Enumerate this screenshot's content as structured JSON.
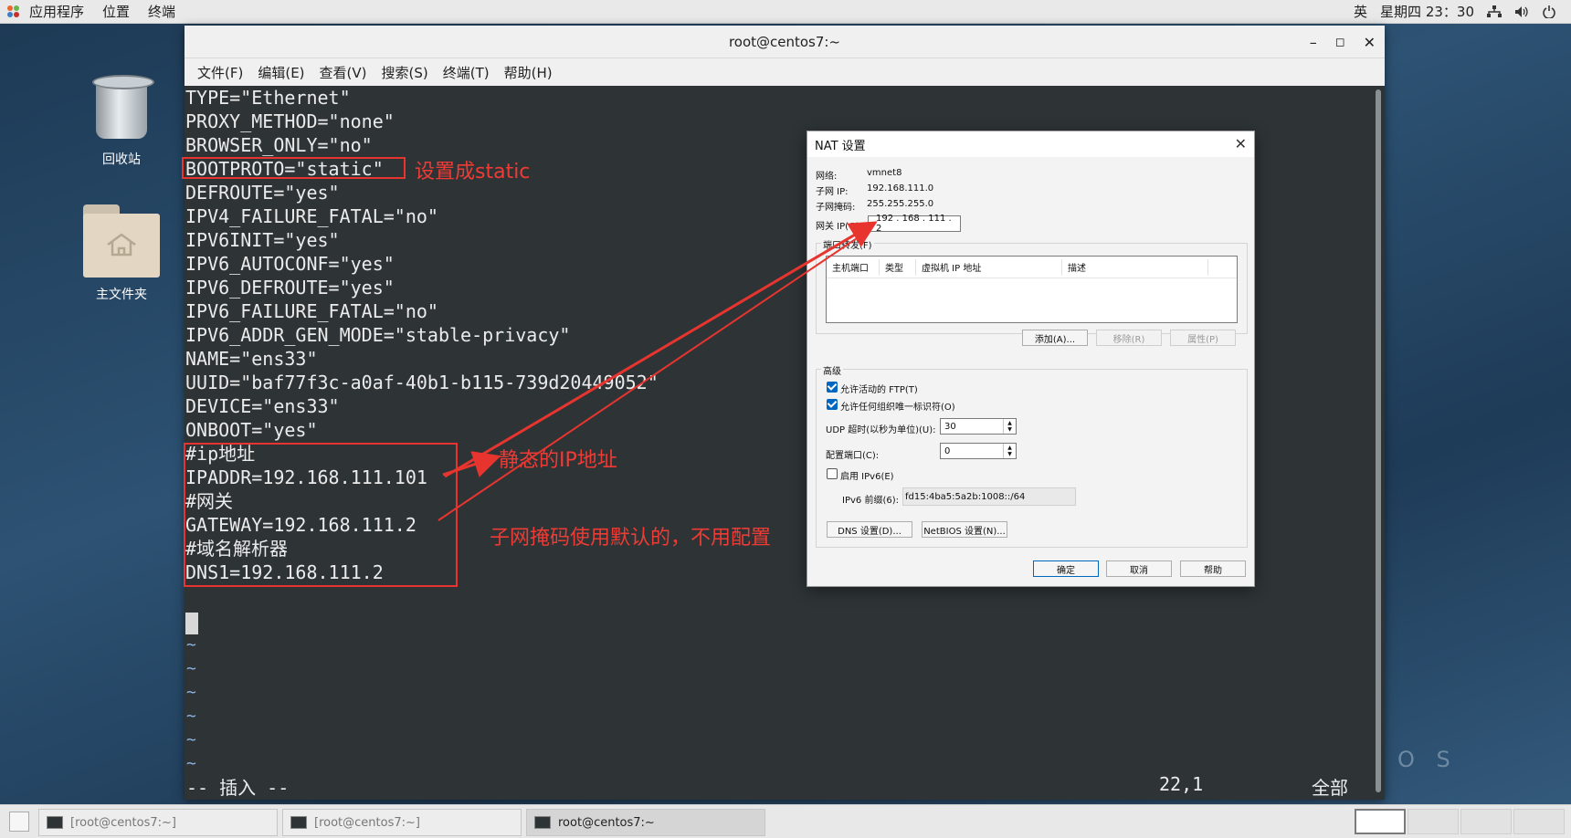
{
  "topbar": {
    "apps": "应用程序",
    "places": "位置",
    "terminal": "终端",
    "ime": "英",
    "clock": "星期四 23：30",
    "icons": [
      "network-icon",
      "volume-icon",
      "power-icon"
    ]
  },
  "desktop": {
    "trash_label": "回收站",
    "home_label": "主文件夹",
    "watermark": "O S"
  },
  "terminal": {
    "title": "root@centos7:~",
    "menu": [
      "文件(F)",
      "编辑(E)",
      "查看(V)",
      "搜索(S)",
      "终端(T)",
      "帮助(H)"
    ],
    "lines": [
      "TYPE=\"Ethernet\"",
      "PROXY_METHOD=\"none\"",
      "BROWSER_ONLY=\"no\"",
      "BOOTPROTO=\"static\"",
      "DEFROUTE=\"yes\"",
      "IPV4_FAILURE_FATAL=\"no\"",
      "IPV6INIT=\"yes\"",
      "IPV6_AUTOCONF=\"yes\"",
      "IPV6_DEFROUTE=\"yes\"",
      "IPV6_FAILURE_FATAL=\"no\"",
      "IPV6_ADDR_GEN_MODE=\"stable-privacy\"",
      "NAME=\"ens33\"",
      "UUID=\"baf77f3c-a0af-40b1-b115-739d20449052\"",
      "DEVICE=\"ens33\"",
      "ONBOOT=\"yes\"",
      "#ip地址",
      "IPADDR=192.168.111.101",
      "#网关",
      "GATEWAY=192.168.111.2",
      "#域名解析器",
      "DNS1=192.168.111.2"
    ],
    "tilde": "~",
    "mode": "-- 插入 --",
    "position": "22,1",
    "scroll": "全部"
  },
  "annotations": {
    "static": "设置成static",
    "static_ip": "静态的IP地址",
    "subnet_note": "子网掩码使用默认的，不用配置"
  },
  "nat_dialog": {
    "title": "NAT 设置",
    "network_label": "网络:",
    "network_value": "vmnet8",
    "subnet_ip_label": "子网 IP:",
    "subnet_ip_value": "192.168.111.0",
    "mask_label": "子网掩码:",
    "mask_value": "255.255.255.0",
    "gateway_label": "网关 IP(G):",
    "gateway_value": "192 . 168 . 111 .  2",
    "port_forward_label": "端口转发(F)",
    "columns": [
      "主机端口",
      "类型",
      "虚拟机 IP 地址",
      "描述"
    ],
    "add_button": "添加(A)...",
    "remove_button": "移除(R)",
    "props_button": "属性(P)",
    "advanced_label": "高级",
    "ftp_check": "允许活动的 FTP(T)",
    "uuid_check": "允许任何组织唯一标识符(O)",
    "udp_label": "UDP 超时(以秒为单位)(U):",
    "udp_value": "30",
    "config_port_label": "配置端口(C):",
    "config_port_value": "0",
    "ipv6_check": "启用 IPv6(E)",
    "ipv6_prefix_label": "IPv6 前缀(6):",
    "ipv6_prefix_value": "fd15:4ba5:5a2b:1008::/64",
    "dns_button": "DNS 设置(D)...",
    "netbios_button": "NetBIOS 设置(N)...",
    "ok_button": "确定",
    "cancel_button": "取消",
    "help_button": "帮助"
  },
  "taskbar": {
    "items": [
      "[root@centos7:~]",
      "[root@centos7:~]",
      "root@centos7:~"
    ]
  },
  "colors": {
    "annotation_red": "#e8342f",
    "terminal_bg": "#2e3436",
    "accent_blue": "#0067c0"
  }
}
